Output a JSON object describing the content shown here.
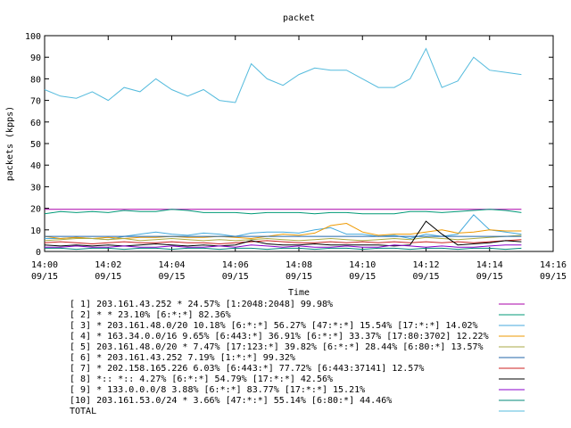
{
  "chart_data": {
    "type": "line",
    "title": "packet",
    "xlabel": "Time",
    "ylabel": "packets (kpps)",
    "ylim": [
      0,
      100
    ],
    "yticks": [
      0,
      10,
      20,
      30,
      40,
      50,
      60,
      70,
      80,
      90,
      100
    ],
    "xlim": [
      0,
      16
    ],
    "xticks": [
      {
        "t": 0,
        "time": "14:00",
        "date": "09/15"
      },
      {
        "t": 2,
        "time": "14:02",
        "date": "09/15"
      },
      {
        "t": 4,
        "time": "14:04",
        "date": "09/15"
      },
      {
        "t": 6,
        "time": "14:06",
        "date": "09/15"
      },
      {
        "t": 8,
        "time": "14:08",
        "date": "09/15"
      },
      {
        "t": 10,
        "time": "14:10",
        "date": "09/15"
      },
      {
        "t": 12,
        "time": "14:12",
        "date": "09/15"
      },
      {
        "t": 14,
        "time": "14:14",
        "date": "09/15"
      },
      {
        "t": 16,
        "time": "14:16",
        "date": "09/15"
      }
    ],
    "x": [
      0,
      0.5,
      1,
      1.5,
      2,
      2.5,
      3,
      3.5,
      4,
      4.5,
      5,
      5.5,
      6,
      6.5,
      7,
      7.5,
      8,
      8.5,
      9,
      9.5,
      10,
      10.5,
      11,
      11.5,
      12,
      12.5,
      13,
      13.5,
      14,
      14.5,
      15
    ],
    "legend_position": "bottom",
    "grid": false,
    "series": [
      {
        "name": "[ 1] 203.161.43.252 * 24.57%  [1:2048:2048] 99.98%",
        "color": "#aa00aa",
        "values": [
          19.5,
          19.5,
          19.5,
          19.5,
          19.5,
          19.5,
          19.5,
          19.5,
          19.5,
          19.5,
          19.5,
          19.5,
          19.5,
          19.5,
          19.5,
          19.5,
          19.5,
          19.5,
          19.5,
          19.5,
          19.5,
          19.5,
          19.5,
          19.5,
          19.5,
          19.5,
          19.5,
          19.5,
          19.5,
          19.5,
          19.5
        ]
      },
      {
        "name": "[ 2] * * 23.10%  [6:*:*] 82.36%",
        "color": "#009977",
        "values": [
          17.5,
          18.5,
          18.0,
          18.5,
          18.0,
          19.0,
          18.5,
          18.5,
          19.5,
          19.0,
          18.0,
          18.0,
          18.0,
          17.5,
          18.0,
          18.0,
          18.0,
          17.5,
          18.0,
          18.0,
          17.5,
          17.5,
          17.5,
          18.5,
          18.5,
          18.0,
          18.5,
          19.0,
          19.5,
          19.0,
          18.0
        ]
      },
      {
        "name": "[ 3] * 203.161.48.0/20 10.18%  [6:*:*] 56.27% [47:*:*] 15.54% [17:*:*] 14.02%",
        "color": "#44aadd",
        "values": [
          6.0,
          6.0,
          6.5,
          6.0,
          5.5,
          7.0,
          8.0,
          9.0,
          8.0,
          7.5,
          8.5,
          8.0,
          7.0,
          8.5,
          9.0,
          9.0,
          8.5,
          10.0,
          11.0,
          8.0,
          8.0,
          7.0,
          7.5,
          6.0,
          8.0,
          7.0,
          8.0,
          17.0,
          10.0,
          9.0,
          8.0
        ]
      },
      {
        "name": "[ 4] * 163.34.0.0/16 9.65%  [6:443:*] 36.91% [6:*:*] 33.37% [17:80:3702] 12.22%",
        "color": "#ee9900",
        "values": [
          7.0,
          6.0,
          6.5,
          6.0,
          6.5,
          6.0,
          6.5,
          6.5,
          7.0,
          6.5,
          6.5,
          7.0,
          6.5,
          6.0,
          7.0,
          8.0,
          7.5,
          8.5,
          12.0,
          13.0,
          9.0,
          7.5,
          8.0,
          8.0,
          9.0,
          10.0,
          8.5,
          9.0,
          10.0,
          9.5,
          9.5
        ]
      },
      {
        "name": "[ 5] 203.161.48.0/20 * 7.47%  [17:123:*] 39.82% [6:*:*] 28.44% [6:80:*] 13.57%",
        "color": "#aaaa44",
        "values": [
          5.0,
          5.5,
          6.0,
          6.0,
          5.5,
          6.0,
          5.0,
          5.5,
          6.0,
          5.5,
          5.0,
          5.5,
          5.0,
          5.5,
          6.0,
          5.5,
          5.0,
          5.5,
          6.0,
          5.5,
          5.0,
          5.5,
          6.0,
          5.5,
          6.5,
          6.0,
          5.5,
          6.0,
          6.5,
          7.0,
          7.5
        ]
      },
      {
        "name": "[ 6] * 203.161.43.252 7.19%  [1:*:*] 99.32%",
        "color": "#2266aa",
        "values": [
          7.0,
          7.0,
          7.0,
          7.0,
          7.0,
          7.0,
          7.0,
          7.0,
          7.0,
          7.0,
          7.0,
          7.0,
          7.0,
          7.0,
          7.0,
          7.0,
          7.0,
          7.0,
          7.0,
          7.0,
          7.0,
          7.0,
          7.0,
          7.0,
          7.0,
          7.0,
          7.0,
          7.0,
          7.0,
          7.0,
          7.0
        ]
      },
      {
        "name": "[ 7] * 202.158.165.226 6.03%  [6:443:*] 77.72% [6:443:37141] 12.57%",
        "color": "#cc2222",
        "values": [
          4.0,
          4.5,
          4.0,
          3.5,
          4.0,
          4.5,
          4.0,
          4.0,
          4.5,
          4.0,
          4.0,
          3.5,
          4.0,
          4.5,
          5.0,
          4.5,
          4.0,
          4.0,
          4.5,
          4.0,
          4.5,
          4.0,
          4.5,
          4.0,
          4.5,
          4.0,
          4.5,
          4.0,
          4.5,
          5.0,
          5.5
        ]
      },
      {
        "name": "[ 8] *:: *:: 4.27%  [6:*:*] 54.79% [17:*:*] 42.56%",
        "color": "#000000",
        "values": [
          3.0,
          2.5,
          3.0,
          2.5,
          3.0,
          2.5,
          3.0,
          3.5,
          3.0,
          2.5,
          3.0,
          2.5,
          3.0,
          5.0,
          3.5,
          3.0,
          3.0,
          3.5,
          3.0,
          3.0,
          3.0,
          3.0,
          2.5,
          3.0,
          14.0,
          8.0,
          3.0,
          3.5,
          4.0,
          5.0,
          4.5
        ]
      },
      {
        "name": "[ 9] * 133.0.0.0/8 3.88%  [6:*:*] 83.77% [17:*:*] 15.21%",
        "color": "#8800cc",
        "values": [
          2.0,
          2.0,
          2.5,
          2.0,
          2.0,
          2.5,
          2.0,
          2.0,
          2.5,
          2.0,
          2.0,
          2.5,
          2.0,
          3.0,
          2.5,
          2.0,
          2.5,
          2.0,
          2.0,
          2.5,
          2.0,
          2.0,
          3.0,
          2.5,
          2.0,
          2.5,
          2.0,
          2.0,
          2.5,
          3.0,
          3.0
        ]
      },
      {
        "name": "[10] 203.161.53.0/24 * 3.66%  [47:*:*] 55.14% [6:80:*] 44.46%",
        "color": "#00887a",
        "values": [
          1.5,
          1.5,
          1.0,
          1.5,
          1.5,
          1.0,
          1.5,
          1.5,
          1.0,
          1.5,
          1.5,
          1.0,
          1.5,
          1.5,
          1.0,
          1.5,
          1.5,
          1.0,
          1.5,
          1.5,
          1.0,
          1.5,
          1.5,
          1.0,
          1.5,
          1.5,
          1.0,
          1.5,
          1.5,
          1.0,
          1.5
        ]
      },
      {
        "name": "TOTAL",
        "color": "#55bbdd",
        "values": [
          75,
          72,
          71,
          74,
          70,
          76,
          74,
          80,
          75,
          72,
          75,
          70,
          69,
          87,
          80,
          77,
          82,
          85,
          84,
          84,
          80,
          76,
          76,
          80,
          94,
          76,
          79,
          90,
          84,
          83,
          82
        ]
      }
    ]
  }
}
